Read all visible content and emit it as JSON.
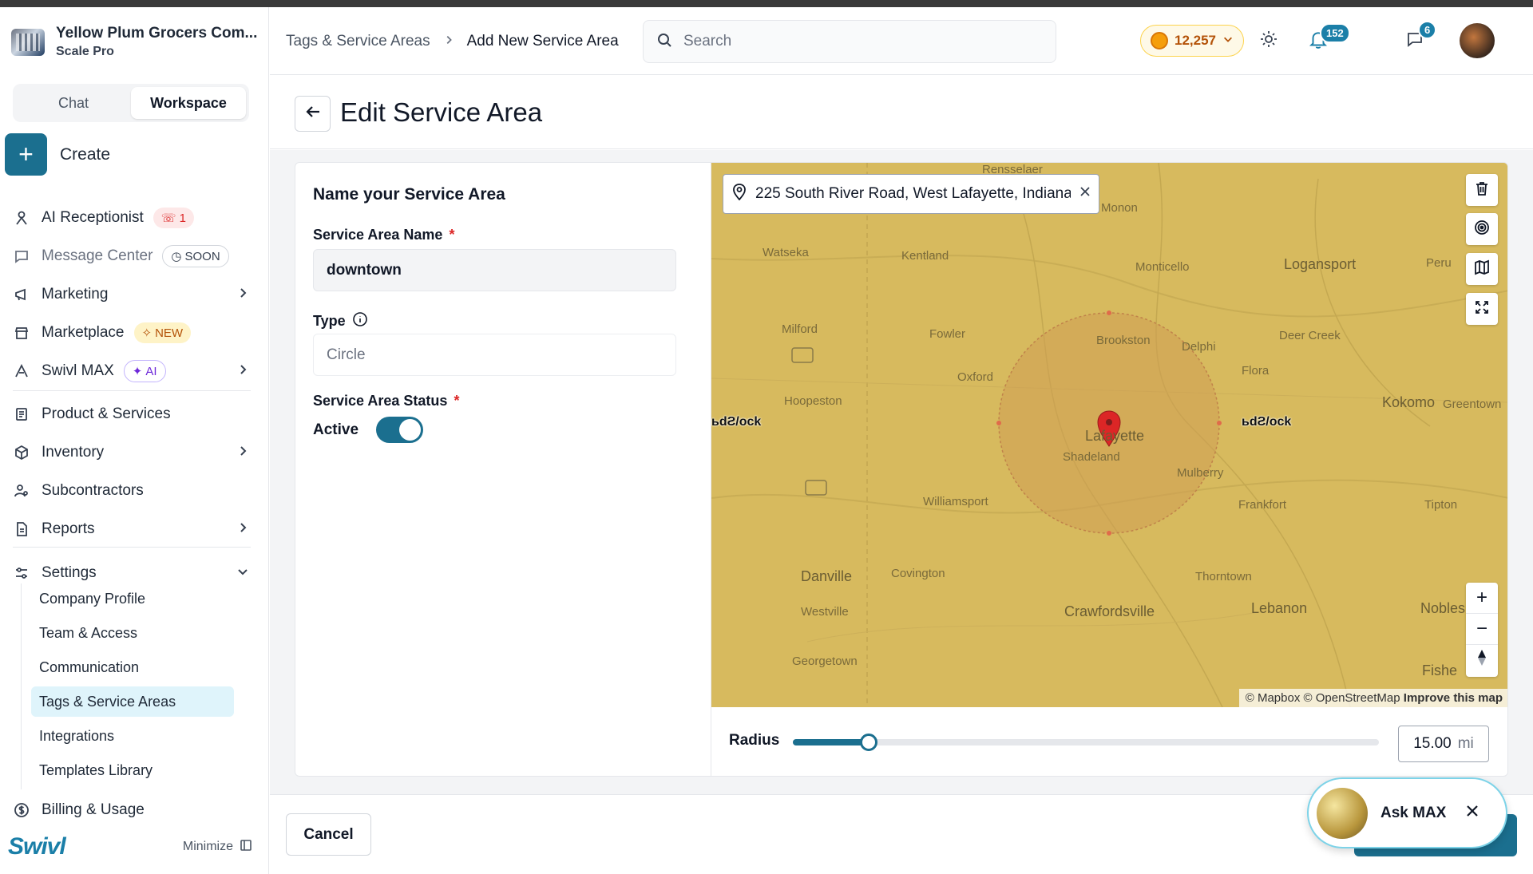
{
  "company": {
    "name": "Yellow Plum Grocers Com...",
    "plan": "Scale Pro"
  },
  "sidebar": {
    "tabs": [
      "Chat",
      "Workspace"
    ],
    "active_tab": "Workspace",
    "create_label": "Create",
    "items": [
      {
        "label": "AI Receptionist",
        "badge": "1",
        "icon": "receptionist-icon"
      },
      {
        "label": "Message Center",
        "badge": "SOON",
        "icon": "message-icon"
      },
      {
        "label": "Marketing",
        "icon": "megaphone-icon"
      },
      {
        "label": "Marketplace",
        "badge": "NEW",
        "icon": "store-icon"
      },
      {
        "label": "Swivl MAX",
        "badge": "AI",
        "icon": "swivl-max-icon"
      },
      {
        "label": "Product & Services",
        "icon": "product-icon"
      },
      {
        "label": "Inventory",
        "icon": "box-icon"
      },
      {
        "label": "Subcontractors",
        "icon": "users-icon"
      },
      {
        "label": "Reports",
        "icon": "report-icon"
      },
      {
        "label": "Settings",
        "icon": "settings-sliders-icon"
      }
    ],
    "settings_items": [
      "Company Profile",
      "Team & Access",
      "Communication",
      "Tags & Service Areas",
      "Integrations",
      "Templates Library"
    ],
    "active_settings_item": "Tags & Service Areas",
    "billing_label": "Billing & Usage",
    "brand": "Swivl",
    "minimize_label": "Minimize"
  },
  "header": {
    "breadcrumb": [
      "Tags & Service Areas",
      "Add New Service Area"
    ],
    "search_placeholder": "Search",
    "points": "12,257",
    "notifications_count": "152",
    "messages_count": "6"
  },
  "page": {
    "title": "Edit Service Area",
    "form": {
      "heading": "Name your Service Area",
      "name_label": "Service Area Name",
      "name_value": "downtown",
      "type_label": "Type",
      "type_value": "Circle",
      "status_label": "Service Area Status",
      "status_value": "Active",
      "required_mark": "*"
    },
    "map": {
      "address": "225 South River Road, West Lafayette, Indiana",
      "attribution_1": "© Mapbox © OpenStreetMap",
      "attribution_2": "Improve this map",
      "edge_label": "ьdƧ/ock",
      "towns": [
        "Rensselaer",
        "Monon",
        "Watseka",
        "Kentland",
        "Monticello",
        "Logansport",
        "Peru",
        "Milford",
        "Fowler",
        "Brookston",
        "Delphi",
        "Deer Creek",
        "Flora",
        "Oxford",
        "Hoopeston",
        "Kokomo",
        "Greentown",
        "Lafayette",
        "Shadeland",
        "Mulberry",
        "Williamsport",
        "Frankfort",
        "Tipton",
        "Danville",
        "Covington",
        "Thorntown",
        "Westville",
        "Crawfordsville",
        "Lebanon",
        "Nobles",
        "Georgetown",
        "Fishe"
      ]
    },
    "radius": {
      "label": "Radius",
      "value": "15.00",
      "unit": "mi",
      "fraction": 0.13
    },
    "cancel_label": "Cancel"
  },
  "ask_max": {
    "label": "Ask MAX"
  }
}
